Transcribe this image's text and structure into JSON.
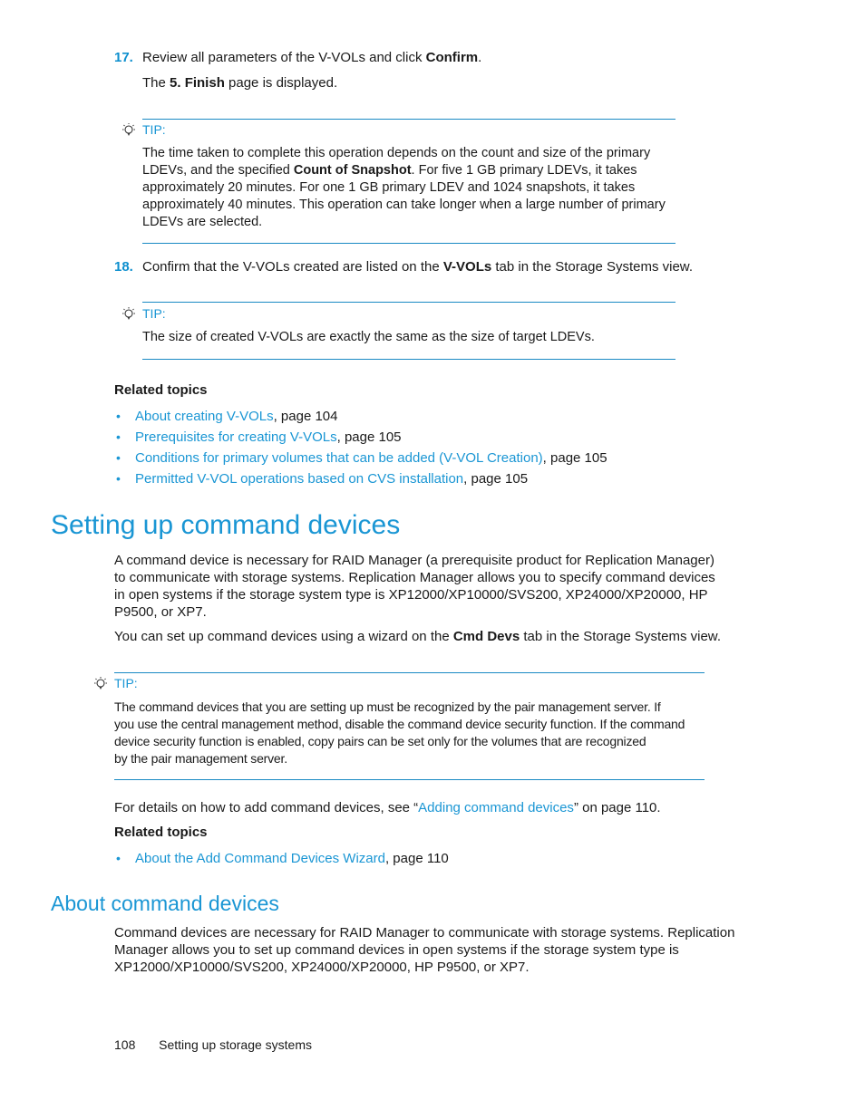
{
  "step17": {
    "number": "17.",
    "text_before": "Review all parameters of the V-VOLs and click ",
    "bold": "Confirm",
    "text_after": ".",
    "result_before": "The ",
    "result_bold": "5. Finish",
    "result_after": " page is displayed."
  },
  "tip1": {
    "label": "TIP:",
    "line1": "The time taken to complete this operation depends on the count and size of the primary",
    "line2_before": "LDEVs, and the specified ",
    "line2_bold": "Count of Snapshot",
    "line2_after": ". For five 1 GB primary LDEVs, it takes",
    "line3": "approximately 20 minutes. For one 1 GB primary LDEV and 1024 snapshots, it takes",
    "line4": "approximately 40 minutes. This operation can take longer when a large number of primary",
    "line5": "LDEVs are selected."
  },
  "step18": {
    "number": "18.",
    "text_before": "Confirm that the V-VOLs created are listed on the ",
    "bold": "V-VOLs",
    "text_after": " tab in the Storage Systems view."
  },
  "tip2": {
    "label": "TIP:",
    "text": "The size of created V-VOLs are exactly the same as the size of target LDEVs."
  },
  "related1": {
    "heading": "Related topics",
    "items": [
      {
        "link": "About creating V-VOLs",
        "suffix": ", page 104"
      },
      {
        "link": "Prerequisites for creating V-VOLs",
        "suffix": ", page 105"
      },
      {
        "link": "Conditions for primary volumes that can be added (V-VOL Creation)",
        "suffix": ", page 105"
      },
      {
        "link": "Permitted V-VOL operations based on CVS installation",
        "suffix": ", page 105"
      }
    ]
  },
  "section1": {
    "title": "Setting up command devices",
    "para1_lines": [
      "A command device is necessary for RAID Manager (a prerequisite product for Replication Manager)",
      "to communicate with storage systems. Replication Manager allows you to specify command devices",
      "in open systems if the storage system type is XP12000/XP10000/SVS200, XP24000/XP20000, HP",
      "P9500, or XP7."
    ],
    "para2_before": "You can set up command devices using a wizard on the ",
    "para2_bold": "Cmd Devs",
    "para2_after": " tab in the Storage Systems view."
  },
  "tip3": {
    "label": "TIP:",
    "lines": [
      "The command devices that you are setting up must be recognized by the pair management server. If",
      "you use the central management method, disable the command device security function. If the command",
      "device security function is enabled, copy pairs can be set only for the volumes that are recognized",
      "by the pair management server."
    ]
  },
  "details": {
    "before": "For details on how to add command devices, see “",
    "link": "Adding command devices",
    "after": "” on page 110."
  },
  "related2": {
    "heading": "Related topics",
    "items": [
      {
        "link": "About the Add Command Devices Wizard",
        "suffix": ", page 110"
      }
    ]
  },
  "section2": {
    "title": "About command devices",
    "lines": [
      "Command devices are necessary for RAID Manager to communicate with storage systems. Replication",
      "Manager allows you to set up command devices in open systems if the storage system type is",
      "XP12000/XP10000/SVS200, XP24000/XP20000, HP P9500, or XP7."
    ]
  },
  "footer": {
    "page_number": "108",
    "section": "Setting up storage systems"
  },
  "colors": {
    "accent": "#1a96d4",
    "rule": "#1a8ac4",
    "text": "#1a1a1a"
  }
}
